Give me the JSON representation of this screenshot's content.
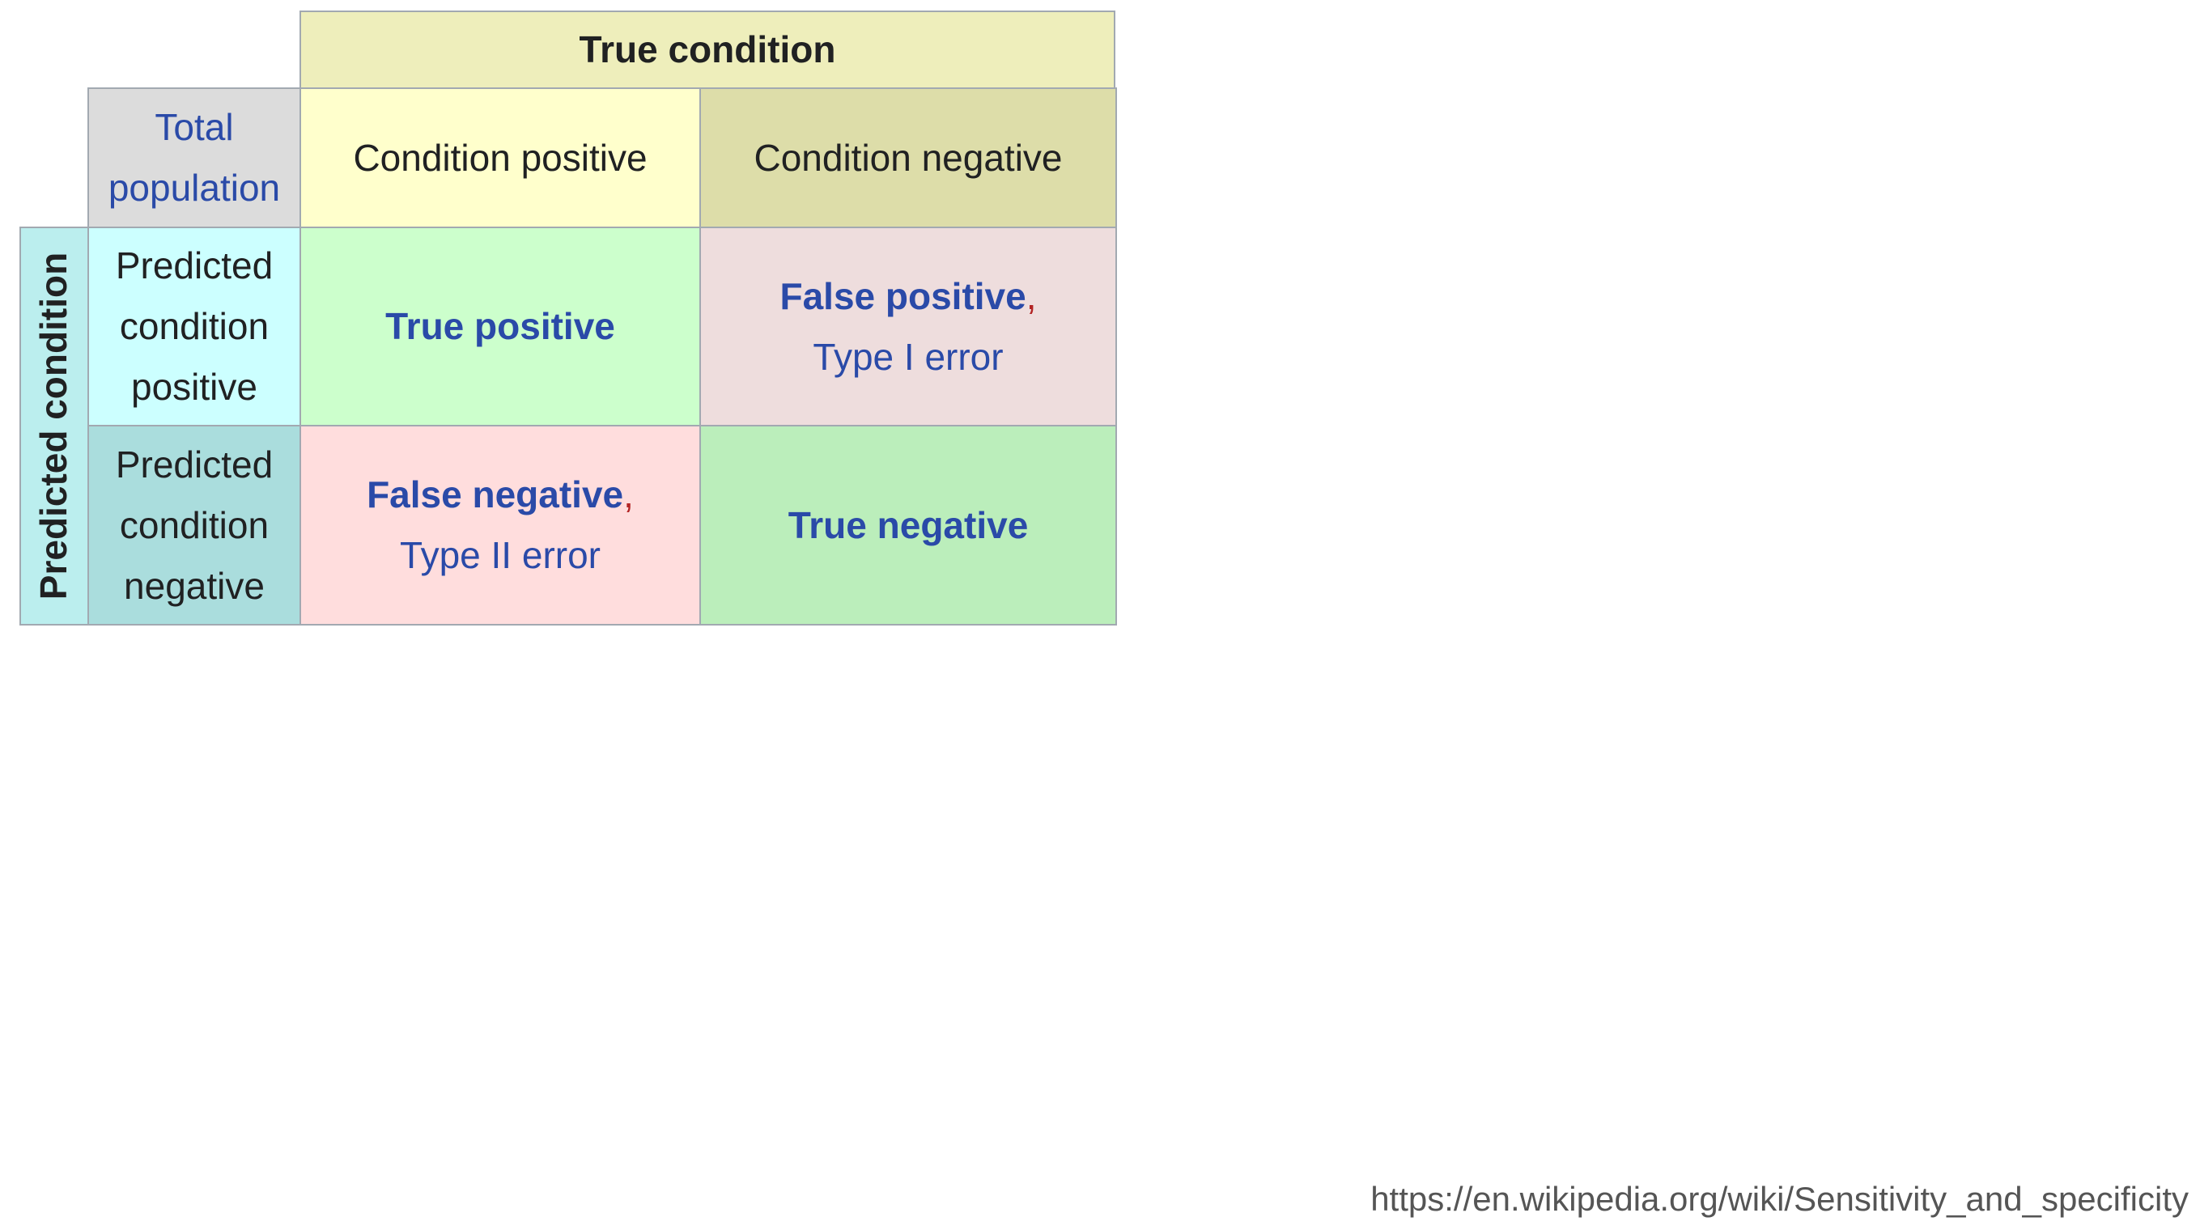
{
  "table": {
    "header_true_condition": "True condition",
    "corner": [
      "Total",
      "population"
    ],
    "condition_positive": "Condition positive",
    "condition_negative": "Condition negative",
    "predicted_condition": "Predicted condition",
    "predicted_positive": [
      "Predicted",
      "condition",
      "positive"
    ],
    "predicted_negative": [
      "Predicted",
      "condition",
      "negative"
    ],
    "true_positive": "True positive",
    "false_positive": {
      "term": "False positive",
      "comma": ",",
      "alias": "Type I error"
    },
    "false_negative": {
      "term": "False negative",
      "comma": ",",
      "alias": "Type II error"
    },
    "true_negative": "True negative"
  },
  "source_url": "https://en.wikipedia.org/wiki/Sensitivity_and_specificity",
  "colors": {
    "link": "#2a4aa8",
    "true_condition_header": "#eeeebb",
    "total_population": "#dcdcdc",
    "condition_positive": "#ffffcc",
    "condition_negative": "#dddda9",
    "predicted_condition": "#bbeeee",
    "predicted_positive": "#ccffff",
    "predicted_negative": "#aadddd",
    "true_positive": "#ccffcc",
    "false_positive": "#eedddd",
    "false_negative": "#ffdddd",
    "true_negative": "#bbeebb"
  }
}
